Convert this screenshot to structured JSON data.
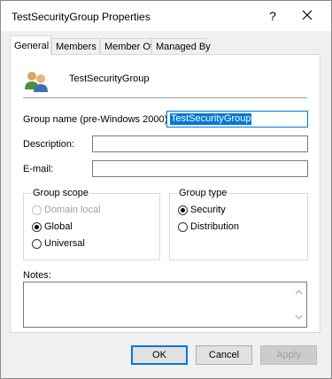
{
  "window": {
    "title": "TestSecurityGroup Properties",
    "help_label": "?"
  },
  "tabs": [
    {
      "label": "General",
      "active": true
    },
    {
      "label": "Members"
    },
    {
      "label": "Member Of"
    },
    {
      "label": "Managed By"
    }
  ],
  "general": {
    "group_display_name": "TestSecurityGroup",
    "group_name_label": "Group name (pre-Windows 2000):",
    "group_name_value": "TestSecurityGroup",
    "description_label": "Description:",
    "description_value": "",
    "email_label": "E-mail:",
    "email_value": "",
    "group_scope": {
      "title": "Group scope",
      "options": [
        {
          "label": "Domain local",
          "checked": false,
          "disabled": true
        },
        {
          "label": "Global",
          "checked": true,
          "disabled": false
        },
        {
          "label": "Universal",
          "checked": false,
          "disabled": false
        }
      ]
    },
    "group_type": {
      "title": "Group type",
      "options": [
        {
          "label": "Security",
          "checked": true
        },
        {
          "label": "Distribution",
          "checked": false
        }
      ]
    },
    "notes_label": "Notes:",
    "notes_value": ""
  },
  "buttons": {
    "ok": "OK",
    "cancel": "Cancel",
    "apply": "Apply"
  },
  "colors": {
    "accent": "#0078d7",
    "window_bg": "#f0f0f0",
    "panel_bg": "#ffffff"
  }
}
